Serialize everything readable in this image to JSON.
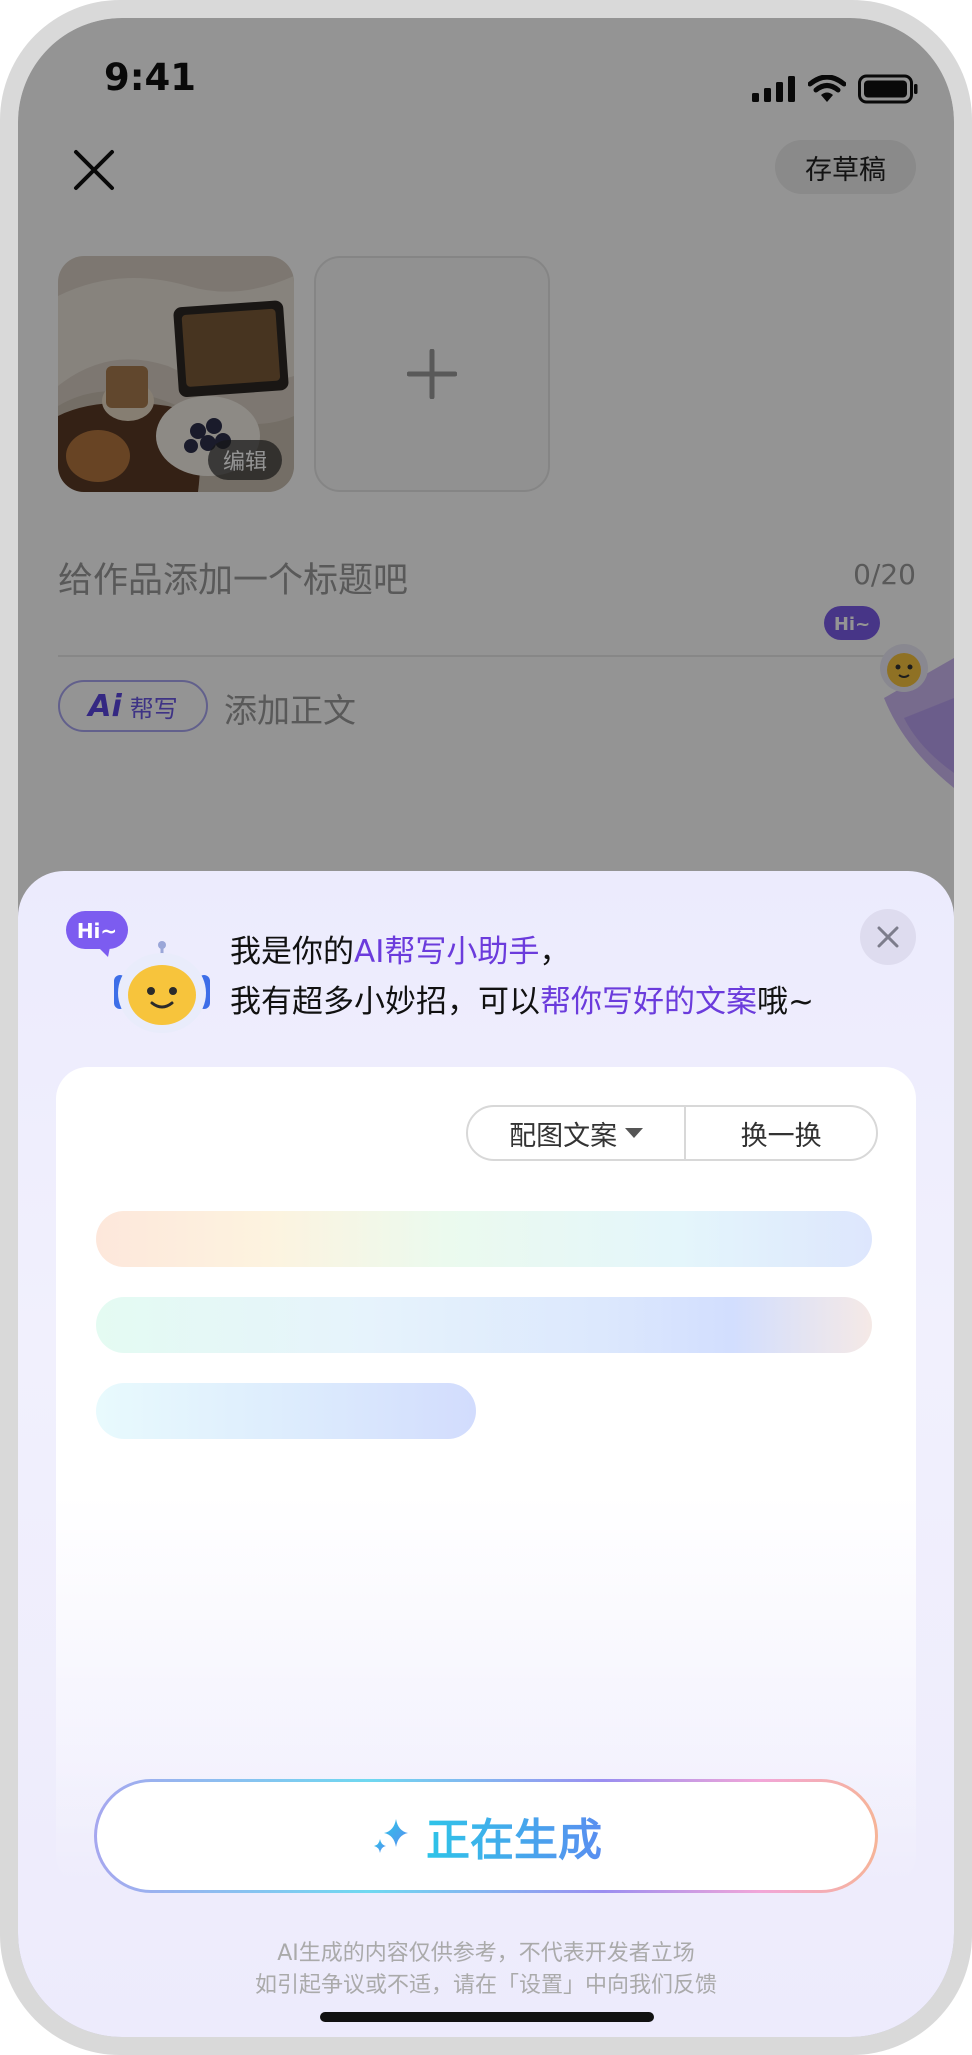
{
  "status_bar": {
    "time": "9:41",
    "icons": [
      "signal-icon",
      "wifi-icon",
      "battery-icon"
    ]
  },
  "header": {
    "close_icon": "close-icon",
    "draft_label": "存草稿"
  },
  "images": {
    "edit_label": "编辑",
    "add_icon": "plus-icon"
  },
  "title_field": {
    "placeholder": "给作品添加一个标题吧",
    "count": "0/20"
  },
  "body_field": {
    "ai_badge_ai": "Ai",
    "ai_badge_label": "帮写",
    "placeholder": "添加正文"
  },
  "mascot": {
    "bubble": "Hi~"
  },
  "sheet": {
    "intro_line1_prefix": "我是你的",
    "intro_line1_highlight": "AI帮写小助手",
    "intro_line1_suffix": "，",
    "intro_line2_prefix": "我有超多小妙招，可以",
    "intro_line2_highlight": "帮你写好的文案",
    "intro_line2_suffix": "哦~",
    "mode_selected": "配图文案",
    "refresh_label": "换一换",
    "generate_label": "正在生成",
    "disclaimer_line1": "AI生成的内容仅供参考，不代表开发者立场",
    "disclaimer_line2": "如引起争议或不适，请在「设置」中向我们反馈"
  },
  "colors": {
    "accent": "#6b3bdc",
    "generate_text": "#3fb6ea",
    "ai_badge": "#5b45e0"
  }
}
